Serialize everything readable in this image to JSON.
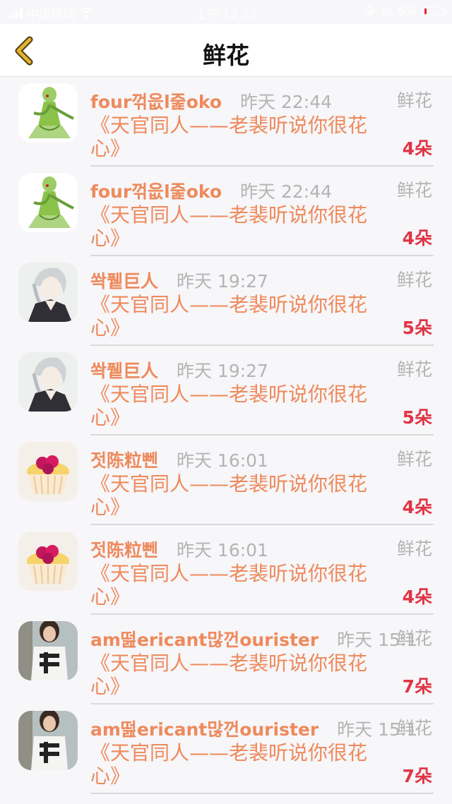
{
  "status_bar": {
    "carrier": "中国移动",
    "time": "上午 12:23",
    "battery": "6%"
  },
  "nav": {
    "title": "鲜花",
    "back_icon": "chevron-left-icon"
  },
  "colors": {
    "accent": "#ee8a5c",
    "count": "#e03546",
    "muted": "#b4b4b4",
    "back_icon": "#e2b230"
  },
  "items": [
    {
      "name": "four꺾읎l줉oko",
      "time": "昨天 22:44",
      "type": "鲜花",
      "title": "《天官同人——老裴听说你很花心》",
      "count": "4朵",
      "avatar": "green-fairy-avatar"
    },
    {
      "name": "four꺾읎l줉oko",
      "time": "昨天 22:44",
      "type": "鲜花",
      "title": "《天官同人——老裴听说你很花心》",
      "count": "4朵",
      "avatar": "green-fairy-avatar"
    },
    {
      "name": "쏵퓉巨人",
      "time": "昨天 19:27",
      "type": "鲜花",
      "title": "《天官同人——老裴听说你很花心》",
      "count": "5朵",
      "avatar": "silver-hair-avatar"
    },
    {
      "name": "쏵퓉巨人",
      "time": "昨天 19:27",
      "type": "鲜花",
      "title": "《天官同人——老裴听说你很花心》",
      "count": "5朵",
      "avatar": "silver-hair-avatar"
    },
    {
      "name": "젓陈粒뻰",
      "time": "昨天 16:01",
      "type": "鲜花",
      "title": "《天官同人——老裴听说你很花心》",
      "count": "4朵",
      "avatar": "cupcake-avatar"
    },
    {
      "name": "젓陈粒뻰",
      "time": "昨天 16:01",
      "type": "鲜花",
      "title": "《天官同人——老裴听说你很花心》",
      "count": "4朵",
      "avatar": "cupcake-avatar"
    },
    {
      "name": "am떮ericant많껀ourister",
      "time": "昨天 15:1",
      "type": "鲜花",
      "title": "《天官同人——老裴听说你很花心》",
      "count": "7朵",
      "avatar": "girl-photo-avatar"
    },
    {
      "name": "am떮ericant많껀ourister",
      "time": "昨天 15:1",
      "type": "鲜花",
      "title": "《天官同人——老裴听说你很花心》",
      "count": "7朵",
      "avatar": "girl-photo-avatar"
    }
  ]
}
